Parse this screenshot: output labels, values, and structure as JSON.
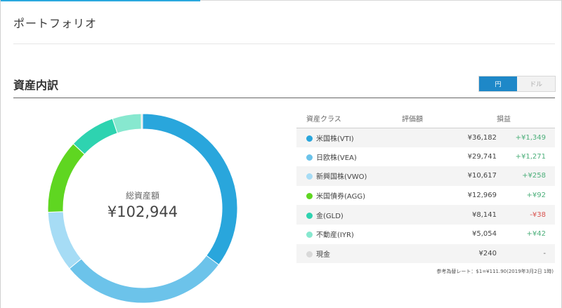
{
  "page": {
    "title": "ポートフォリオ"
  },
  "section": {
    "title": "資産内訳",
    "currency_toggle": {
      "yen": "円",
      "dollar": "ドル",
      "selected": "円"
    }
  },
  "donut": {
    "center_label": "総資産額",
    "total": "¥102,944"
  },
  "table": {
    "headers": {
      "asset_class": "資産クラス",
      "valuation": "評価額",
      "gain": "損益"
    },
    "rows": [
      {
        "name": "米国株(VTI)",
        "value": "¥36,182",
        "gain": "+¥1,349",
        "sign": "pos",
        "color": "#29a6dc"
      },
      {
        "name": "日欧株(VEA)",
        "value": "¥29,741",
        "gain": "+¥1,271",
        "sign": "pos",
        "color": "#6cc3ea"
      },
      {
        "name": "新興国株(VWO)",
        "value": "¥10,617",
        "gain": "+¥258",
        "sign": "pos",
        "color": "#a6dcf5"
      },
      {
        "name": "米国債券(AGG)",
        "value": "¥12,969",
        "gain": "+¥92",
        "sign": "pos",
        "color": "#5fd621"
      },
      {
        "name": "金(GLD)",
        "value": "¥8,141",
        "gain": "-¥38",
        "sign": "neg",
        "color": "#2ed3b0"
      },
      {
        "name": "不動産(IYR)",
        "value": "¥5,054",
        "gain": "+¥42",
        "sign": "pos",
        "color": "#87e8cf"
      },
      {
        "name": "現金",
        "value": "¥240",
        "gain": "-",
        "sign": "none",
        "color": "#d9d9d9"
      }
    ]
  },
  "chart_data": {
    "type": "pie",
    "categories": [
      "米国株(VTI)",
      "日欧株(VEA)",
      "新興国株(VWO)",
      "米国債券(AGG)",
      "金(GLD)",
      "不動産(IYR)",
      "現金"
    ],
    "values": [
      36182,
      29741,
      10617,
      12969,
      8141,
      5054,
      240
    ],
    "colors": [
      "#29a6dc",
      "#6cc3ea",
      "#a6dcf5",
      "#5fd621",
      "#2ed3b0",
      "#87e8cf",
      "#d9d9d9"
    ],
    "donut": true
  },
  "footnote": "参考為替レート：$1=¥111.90(2019年3月2日 1時)"
}
